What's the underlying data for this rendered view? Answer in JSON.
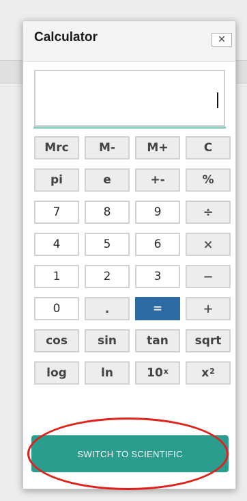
{
  "window": {
    "title": "Calculator",
    "close_symbol": "✕"
  },
  "display": {
    "value": ""
  },
  "keys": [
    {
      "label": "Mrc",
      "style": "gray",
      "name": "key-mrc"
    },
    {
      "label": "M-",
      "style": "gray",
      "name": "key-m-minus"
    },
    {
      "label": "M+",
      "style": "gray",
      "name": "key-m-plus"
    },
    {
      "label": "C",
      "style": "gray",
      "name": "key-clear"
    },
    {
      "label": "pi",
      "style": "gray",
      "name": "key-pi"
    },
    {
      "label": "e",
      "style": "gray",
      "name": "key-e"
    },
    {
      "label": "+-",
      "style": "gray",
      "name": "key-plus-minus"
    },
    {
      "label": "%",
      "style": "gray",
      "name": "key-percent"
    },
    {
      "label": "7",
      "style": "num",
      "name": "key-7"
    },
    {
      "label": "8",
      "style": "num",
      "name": "key-8"
    },
    {
      "label": "9",
      "style": "num",
      "name": "key-9"
    },
    {
      "label": "÷",
      "style": "op",
      "name": "key-divide"
    },
    {
      "label": "4",
      "style": "num",
      "name": "key-4"
    },
    {
      "label": "5",
      "style": "num",
      "name": "key-5"
    },
    {
      "label": "6",
      "style": "num",
      "name": "key-6"
    },
    {
      "label": "×",
      "style": "op",
      "name": "key-multiply"
    },
    {
      "label": "1",
      "style": "num",
      "name": "key-1"
    },
    {
      "label": "2",
      "style": "num",
      "name": "key-2"
    },
    {
      "label": "3",
      "style": "num",
      "name": "key-3"
    },
    {
      "label": "−",
      "style": "op",
      "name": "key-subtract"
    },
    {
      "label": "0",
      "style": "num",
      "name": "key-0"
    },
    {
      "label": ".",
      "style": "op",
      "name": "key-decimal"
    },
    {
      "label": "=",
      "style": "eq",
      "name": "key-equals"
    },
    {
      "label": "+",
      "style": "op",
      "name": "key-add"
    },
    {
      "label": "cos",
      "style": "gray",
      "name": "key-cos"
    },
    {
      "label": "sin",
      "style": "gray",
      "name": "key-sin"
    },
    {
      "label": "tan",
      "style": "gray",
      "name": "key-tan"
    },
    {
      "label": "sqrt",
      "style": "gray",
      "name": "key-sqrt"
    },
    {
      "label": "log",
      "style": "gray",
      "name": "key-log"
    },
    {
      "label": "ln",
      "style": "gray",
      "name": "key-ln"
    },
    {
      "label": "10",
      "sup": "x",
      "style": "gray",
      "name": "key-ten-power"
    },
    {
      "label": "x",
      "sup": "2",
      "style": "gray",
      "name": "key-square"
    }
  ],
  "switch_button": {
    "label": "SWITCH TO SCIENTIFIC"
  },
  "colors": {
    "accent_teal": "#2a9d8f",
    "equals_blue": "#2c6aa4",
    "highlight_red": "#e0201a"
  }
}
